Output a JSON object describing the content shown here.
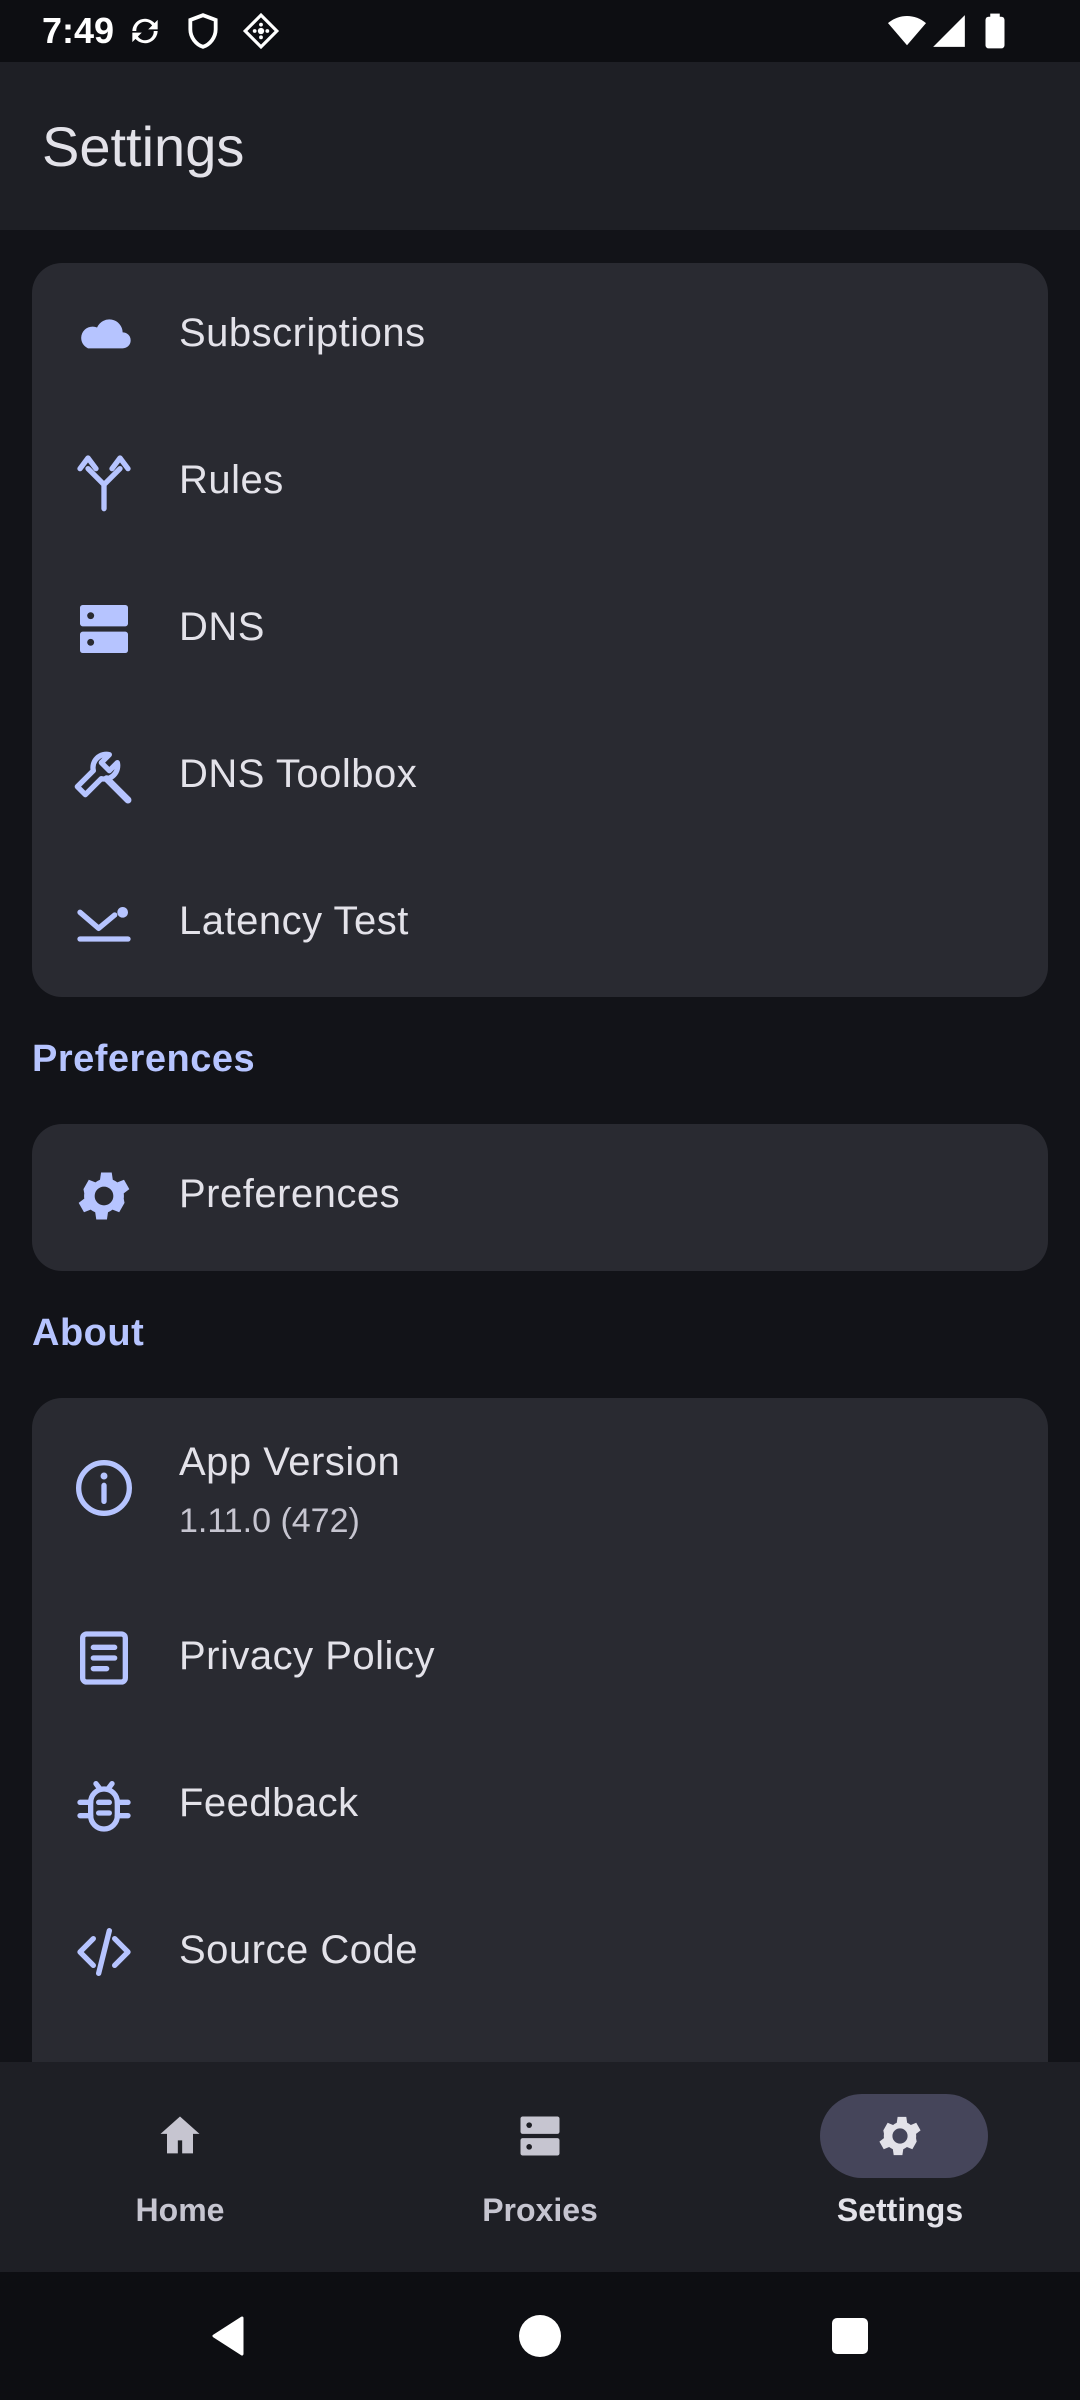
{
  "status_bar": {
    "time": "7:49",
    "icons": [
      "sync-icon",
      "shield-icon",
      "vpn-key-icon",
      "wifi-icon",
      "signal-icon",
      "battery-icon"
    ]
  },
  "app_bar": {
    "title": "Settings"
  },
  "main_card": {
    "items": [
      {
        "label": "Subscriptions",
        "icon": "cloud-icon"
      },
      {
        "label": "Rules",
        "icon": "fork-icon"
      },
      {
        "label": "DNS",
        "icon": "dns-server-icon"
      },
      {
        "label": "DNS Toolbox",
        "icon": "wrench-icon"
      },
      {
        "label": "Latency Test",
        "icon": "latency-icon"
      }
    ]
  },
  "preferences_section": {
    "header": "Preferences",
    "items": [
      {
        "label": "Preferences",
        "icon": "gear-icon"
      }
    ]
  },
  "about_section": {
    "header": "About",
    "items": [
      {
        "label": "App Version",
        "value": "1.11.0 (472)",
        "icon": "info-icon"
      },
      {
        "label": "Privacy Policy",
        "icon": "document-icon"
      },
      {
        "label": "Feedback",
        "icon": "bug-icon"
      },
      {
        "label": "Source Code",
        "icon": "code-icon"
      }
    ]
  },
  "bottom_nav": {
    "items": [
      {
        "label": "Home",
        "icon": "home-icon",
        "active": false
      },
      {
        "label": "Proxies",
        "icon": "server-icon",
        "active": false
      },
      {
        "label": "Settings",
        "icon": "gear-icon",
        "active": true
      }
    ]
  },
  "system_nav": {
    "icons": [
      "back-icon",
      "home-circle-icon",
      "recents-icon"
    ]
  },
  "colors": {
    "background": "#121318",
    "surface": "#292A31",
    "accent": "#B6C4FF",
    "active_pill": "#45455A"
  }
}
